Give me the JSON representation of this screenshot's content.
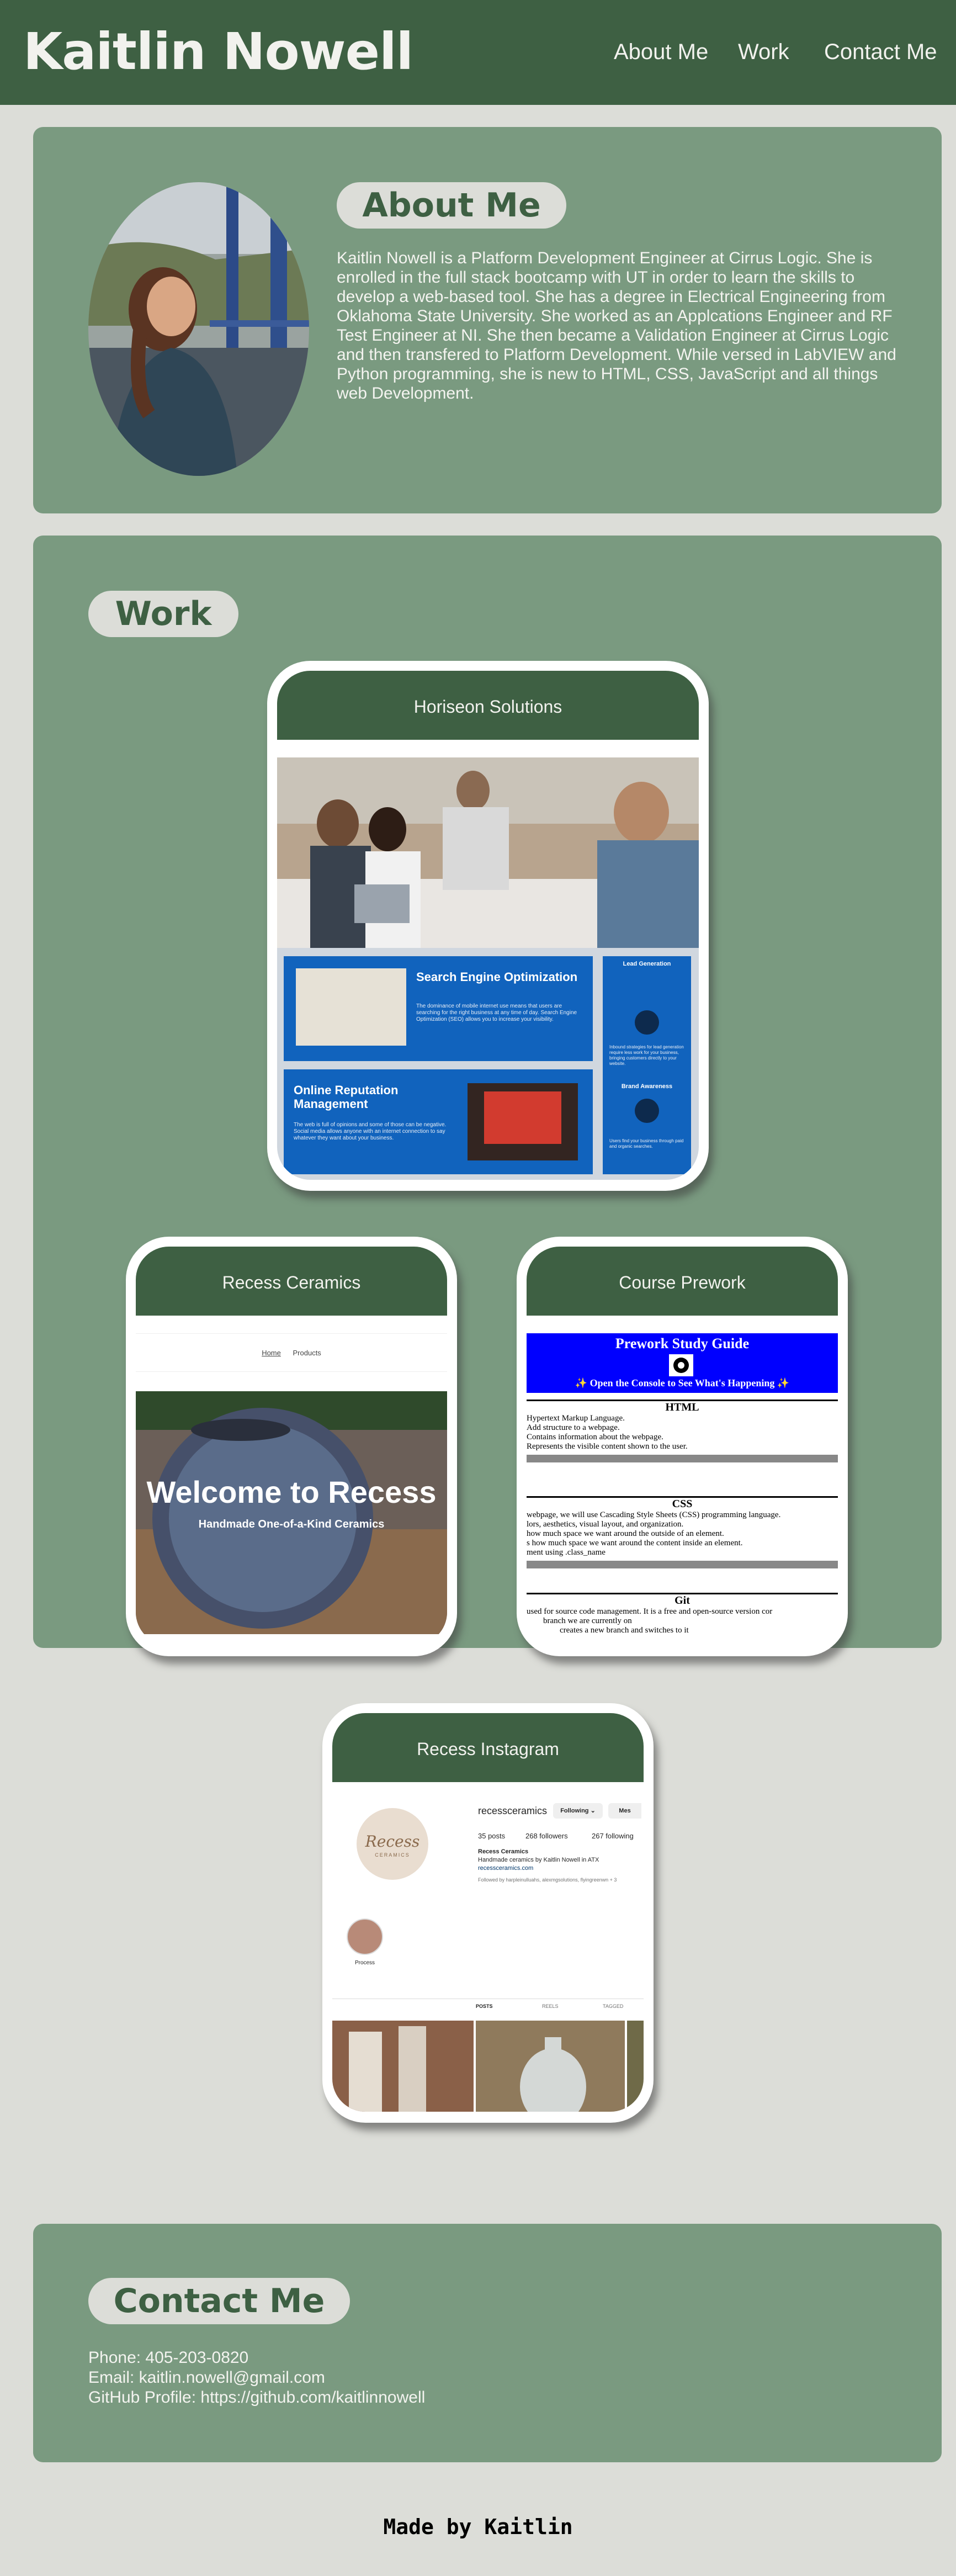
{
  "header": {
    "brand": "Kaitlin Nowell",
    "nav": [
      "About Me",
      "Work",
      "Contact Me"
    ]
  },
  "about": {
    "heading": "About Me",
    "text": "Kaitlin Nowell is a Platform Development Engineer at Cirrus Logic. She is enrolled in the full stack bootcamp with UT in order to learn the skills to develop a web-based tool. She has a degree in Electrical Engineering from Oklahoma State University. She worked as an Applcations Engineer and RF Test Engineer at NI. She then became a Validation Engineer at Cirrus Logic and then transfered to Platform Development. While versed in LabVIEW and Python programming, she is new to HTML, CSS, JavaScript and all things web Development."
  },
  "work": {
    "heading": "Work",
    "projects": [
      {
        "title": "Horiseon Solutions",
        "screenshot": {
          "seo_title": "Search Engine Optimization",
          "seo_body": "The dominance of mobile internet use means that users are searching for the right business at any time of day. Search Engine Optimization (SEO) allows you to increase your visibility.",
          "orm_title": "Online Reputation Management",
          "orm_body": "The web is full of opinions and some of those can be negative. Social media allows anyone with an internet connection to say whatever they want about your business.",
          "side_title_1": "Lead Generation",
          "side_body_1": "Inbound strategies for lead generation require less work for your business, bringing customers directly to your website.",
          "side_title_2": "Brand Awareness",
          "side_body_2": "Users find your business through paid and organic searches."
        }
      },
      {
        "title": "Recess Ceramics",
        "screenshot": {
          "nav": [
            "Home",
            "Products"
          ],
          "hero_title": "Welcome to Recess",
          "hero_subtitle": "Handmade One-of-a-Kind Ceramics"
        }
      },
      {
        "title": "Course Prework",
        "screenshot": {
          "banner_title": "Prework Study Guide",
          "banner_sub": "✨ Open the Console to See What's Happening ✨",
          "sections": [
            {
              "title": "HTML",
              "lines": [
                "Hypertext Markup Language.",
                "Add structure to a webpage.",
                "Contains information about the webpage.",
                "Represents the visible content shown to the user."
              ]
            },
            {
              "title": "CSS",
              "lines": [
                "webpage, we will use Cascading Style Sheets (CSS) programming language.",
                "lors, aesthetics, visual layout, and organization.",
                "how much space we want around the outside of an element.",
                "s how much space we want around the content inside an element.",
                "ment using .class_name"
              ]
            },
            {
              "title": "Git",
              "lines": [
                "used for source code management. It is a free and open-source version cor",
                "branch we are currently on",
                "creates a new branch and switches to it"
              ]
            }
          ]
        }
      },
      {
        "title": "Recess Instagram",
        "screenshot": {
          "username": "recessceramics",
          "following_btn": "Following ⌄",
          "message_btn": "Mes",
          "posts": "35 posts",
          "followers": "268 followers",
          "following": "267 following",
          "bio_name": "Recess Ceramics",
          "bio_line": "Handmade ceramics by Kaitlin Nowell in ATX",
          "bio_link": "recessceramics.com",
          "followed_by": "Followed by harpleinulluahs, alexmgsolutions, flyingreenwn + 3",
          "highlight_label": "Process",
          "logo_text": "Recess",
          "logo_sub": "CERAMICS",
          "tabs": [
            "POSTS",
            "REELS",
            "TAGGED"
          ]
        }
      }
    ]
  },
  "contact": {
    "heading": "Contact Me",
    "phone": "Phone: 405-203-0820",
    "email": "Email: kaitlin.nowell@gmail.com",
    "github": "GitHub Profile: https://github.com/kaitlinnowell"
  },
  "footer": {
    "text": "Made by Kaitlin"
  },
  "colors": {
    "header": "#3e6043",
    "panel": "#7a9a80",
    "background": "#dcddd8",
    "pill": "#dcddd8"
  }
}
